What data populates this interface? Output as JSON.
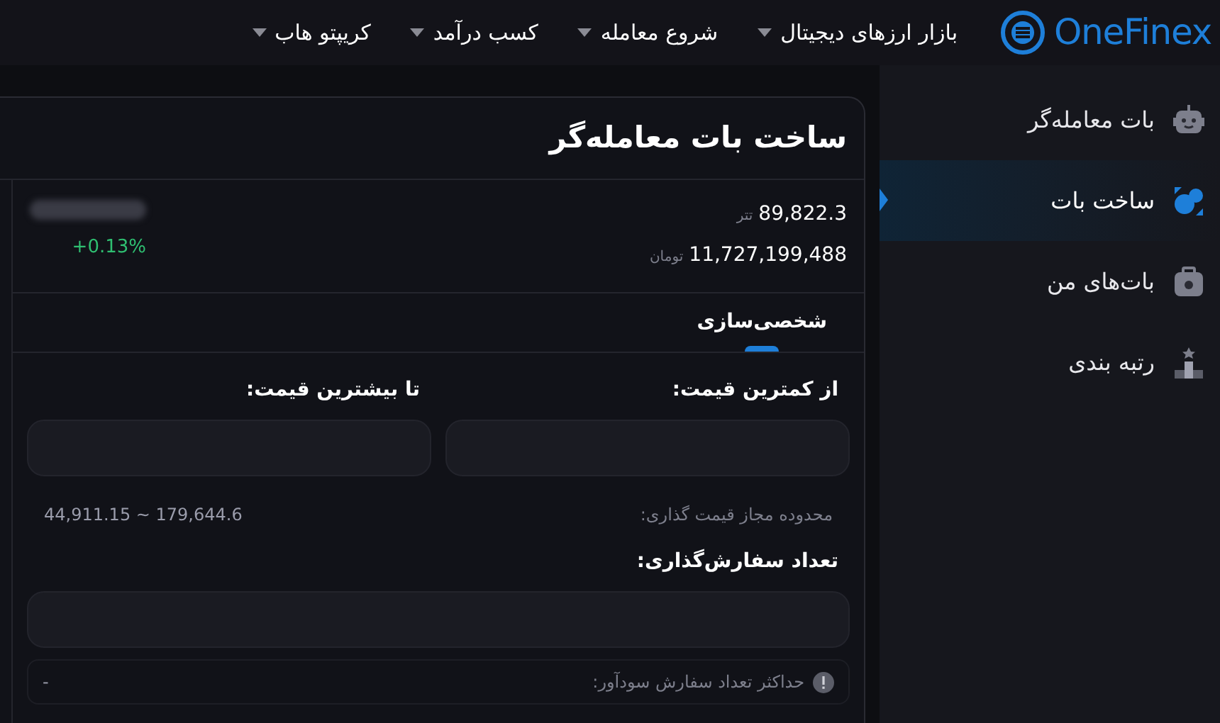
{
  "header": {
    "logo": "OneFinex",
    "nav": [
      {
        "label": "بازار ارزهای دیجیتال"
      },
      {
        "label": "شروع معامله"
      },
      {
        "label": "کسب درآمد"
      },
      {
        "label": "کریپتو هاب"
      }
    ]
  },
  "sidebar": {
    "items": [
      {
        "label": "بات معامله‌گر",
        "selected": false,
        "kind": "robot"
      },
      {
        "label": "ساخت بات",
        "selected": true,
        "kind": "build"
      },
      {
        "label": "بات‌های من",
        "selected": false,
        "kind": "bag"
      },
      {
        "label": "رتبه بندی",
        "selected": false,
        "kind": "rank"
      }
    ]
  },
  "panel": {
    "title": "ساخت بات معامله‌گر",
    "usdt_price": "89,822.3",
    "usdt_unit": "تتر",
    "toman_price": "11,727,199,488",
    "toman_unit": "تومان",
    "change": "+0.13%",
    "tabs": [
      {
        "label": "شخصی‌سازی",
        "selected": true
      }
    ],
    "form": {
      "min_label": "از کمترین قیمت:",
      "max_label": "تا بیشترین قیمت:",
      "range_label": "محدوده مجاز قیمت گذاری:",
      "range_value": "44,911.15 ~ 179,644.6",
      "count_label": "تعداد سفارش‌گذاری:",
      "max_orders_label": "حداکثر تعداد سفارش سودآور:",
      "max_orders_value": "-"
    }
  }
}
